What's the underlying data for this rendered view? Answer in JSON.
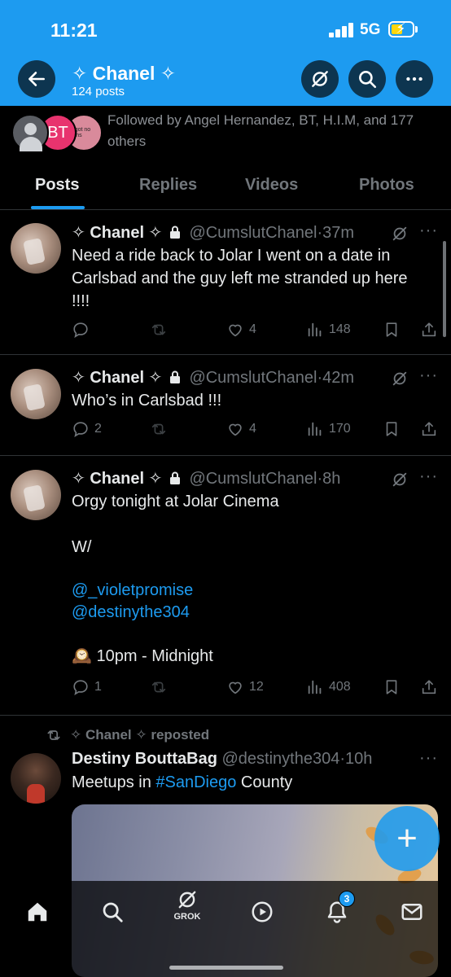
{
  "status_bar": {
    "time": "11:21",
    "network": "5G"
  },
  "header": {
    "title": "✧ Chanel ✧",
    "subtitle": "124 posts"
  },
  "followed_by": {
    "text": "Followed by Angel Hernandez, BT, H.I.M, and 177 others",
    "avatar_initials": "BT",
    "avatar3_text": "he got no thighs"
  },
  "tabs": [
    "Posts",
    "Replies",
    "Videos",
    "Photos"
  ],
  "tweets": [
    {
      "name": "✧ Chanel ✧",
      "handle": "@CumslutChanel",
      "time": "·37m",
      "text": "Need a ride back to Jolar I went on a date in Carlsbad and the guy left me stranded up here !!!!",
      "replies": "",
      "likes": "4",
      "views": "148"
    },
    {
      "name": "✧ Chanel ✧",
      "handle": "@CumslutChanel",
      "time": "·42m",
      "text": "Who’s in Carlsbad !!!",
      "replies": "2",
      "likes": "4",
      "views": "170"
    },
    {
      "name": "✧ Chanel ✧",
      "handle": "@CumslutChanel",
      "time": "·8h",
      "text_line1": "Orgy tonight at Jolar Cinema",
      "text_line2": "W/",
      "mention1": "@_violetpromise",
      "mention2": "@destinythe304",
      "time_text": "🕰️ 10pm - Midnight",
      "replies": "1",
      "likes": "12",
      "views": "408"
    }
  ],
  "repost": {
    "label": "✧ Chanel ✧ reposted",
    "name": "Destiny BouttaBag",
    "handle": "@destinythe304",
    "time": "·10h",
    "text_before": "Meetups in ",
    "hashtag": "#SanDiego",
    "text_after": " County"
  },
  "fab_label": "+",
  "more_label": "···",
  "bottom_nav": {
    "grok_label": "GROK",
    "notifications_badge": "3"
  },
  "colors": {
    "accent": "#1d9bf0",
    "background": "#000000",
    "muted": "#71767b"
  }
}
